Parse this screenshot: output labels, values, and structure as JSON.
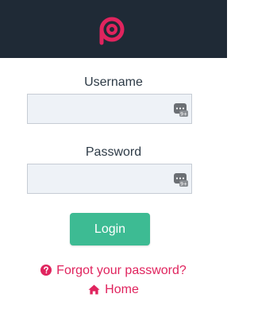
{
  "header": {
    "logo_icon": "brand-p-logo",
    "bg_color": "#1f2a36",
    "accent_color": "#e0245e"
  },
  "form": {
    "username_label": "Username",
    "username_value": "",
    "password_label": "Password",
    "password_value": "",
    "field_icon": "password-manager-icon",
    "login_label": "Login",
    "login_color": "#3dbb93"
  },
  "links": {
    "forgot_label": "Forgot your password?",
    "forgot_icon": "question-circle-icon",
    "home_label": "Home",
    "home_icon": "home-icon"
  }
}
